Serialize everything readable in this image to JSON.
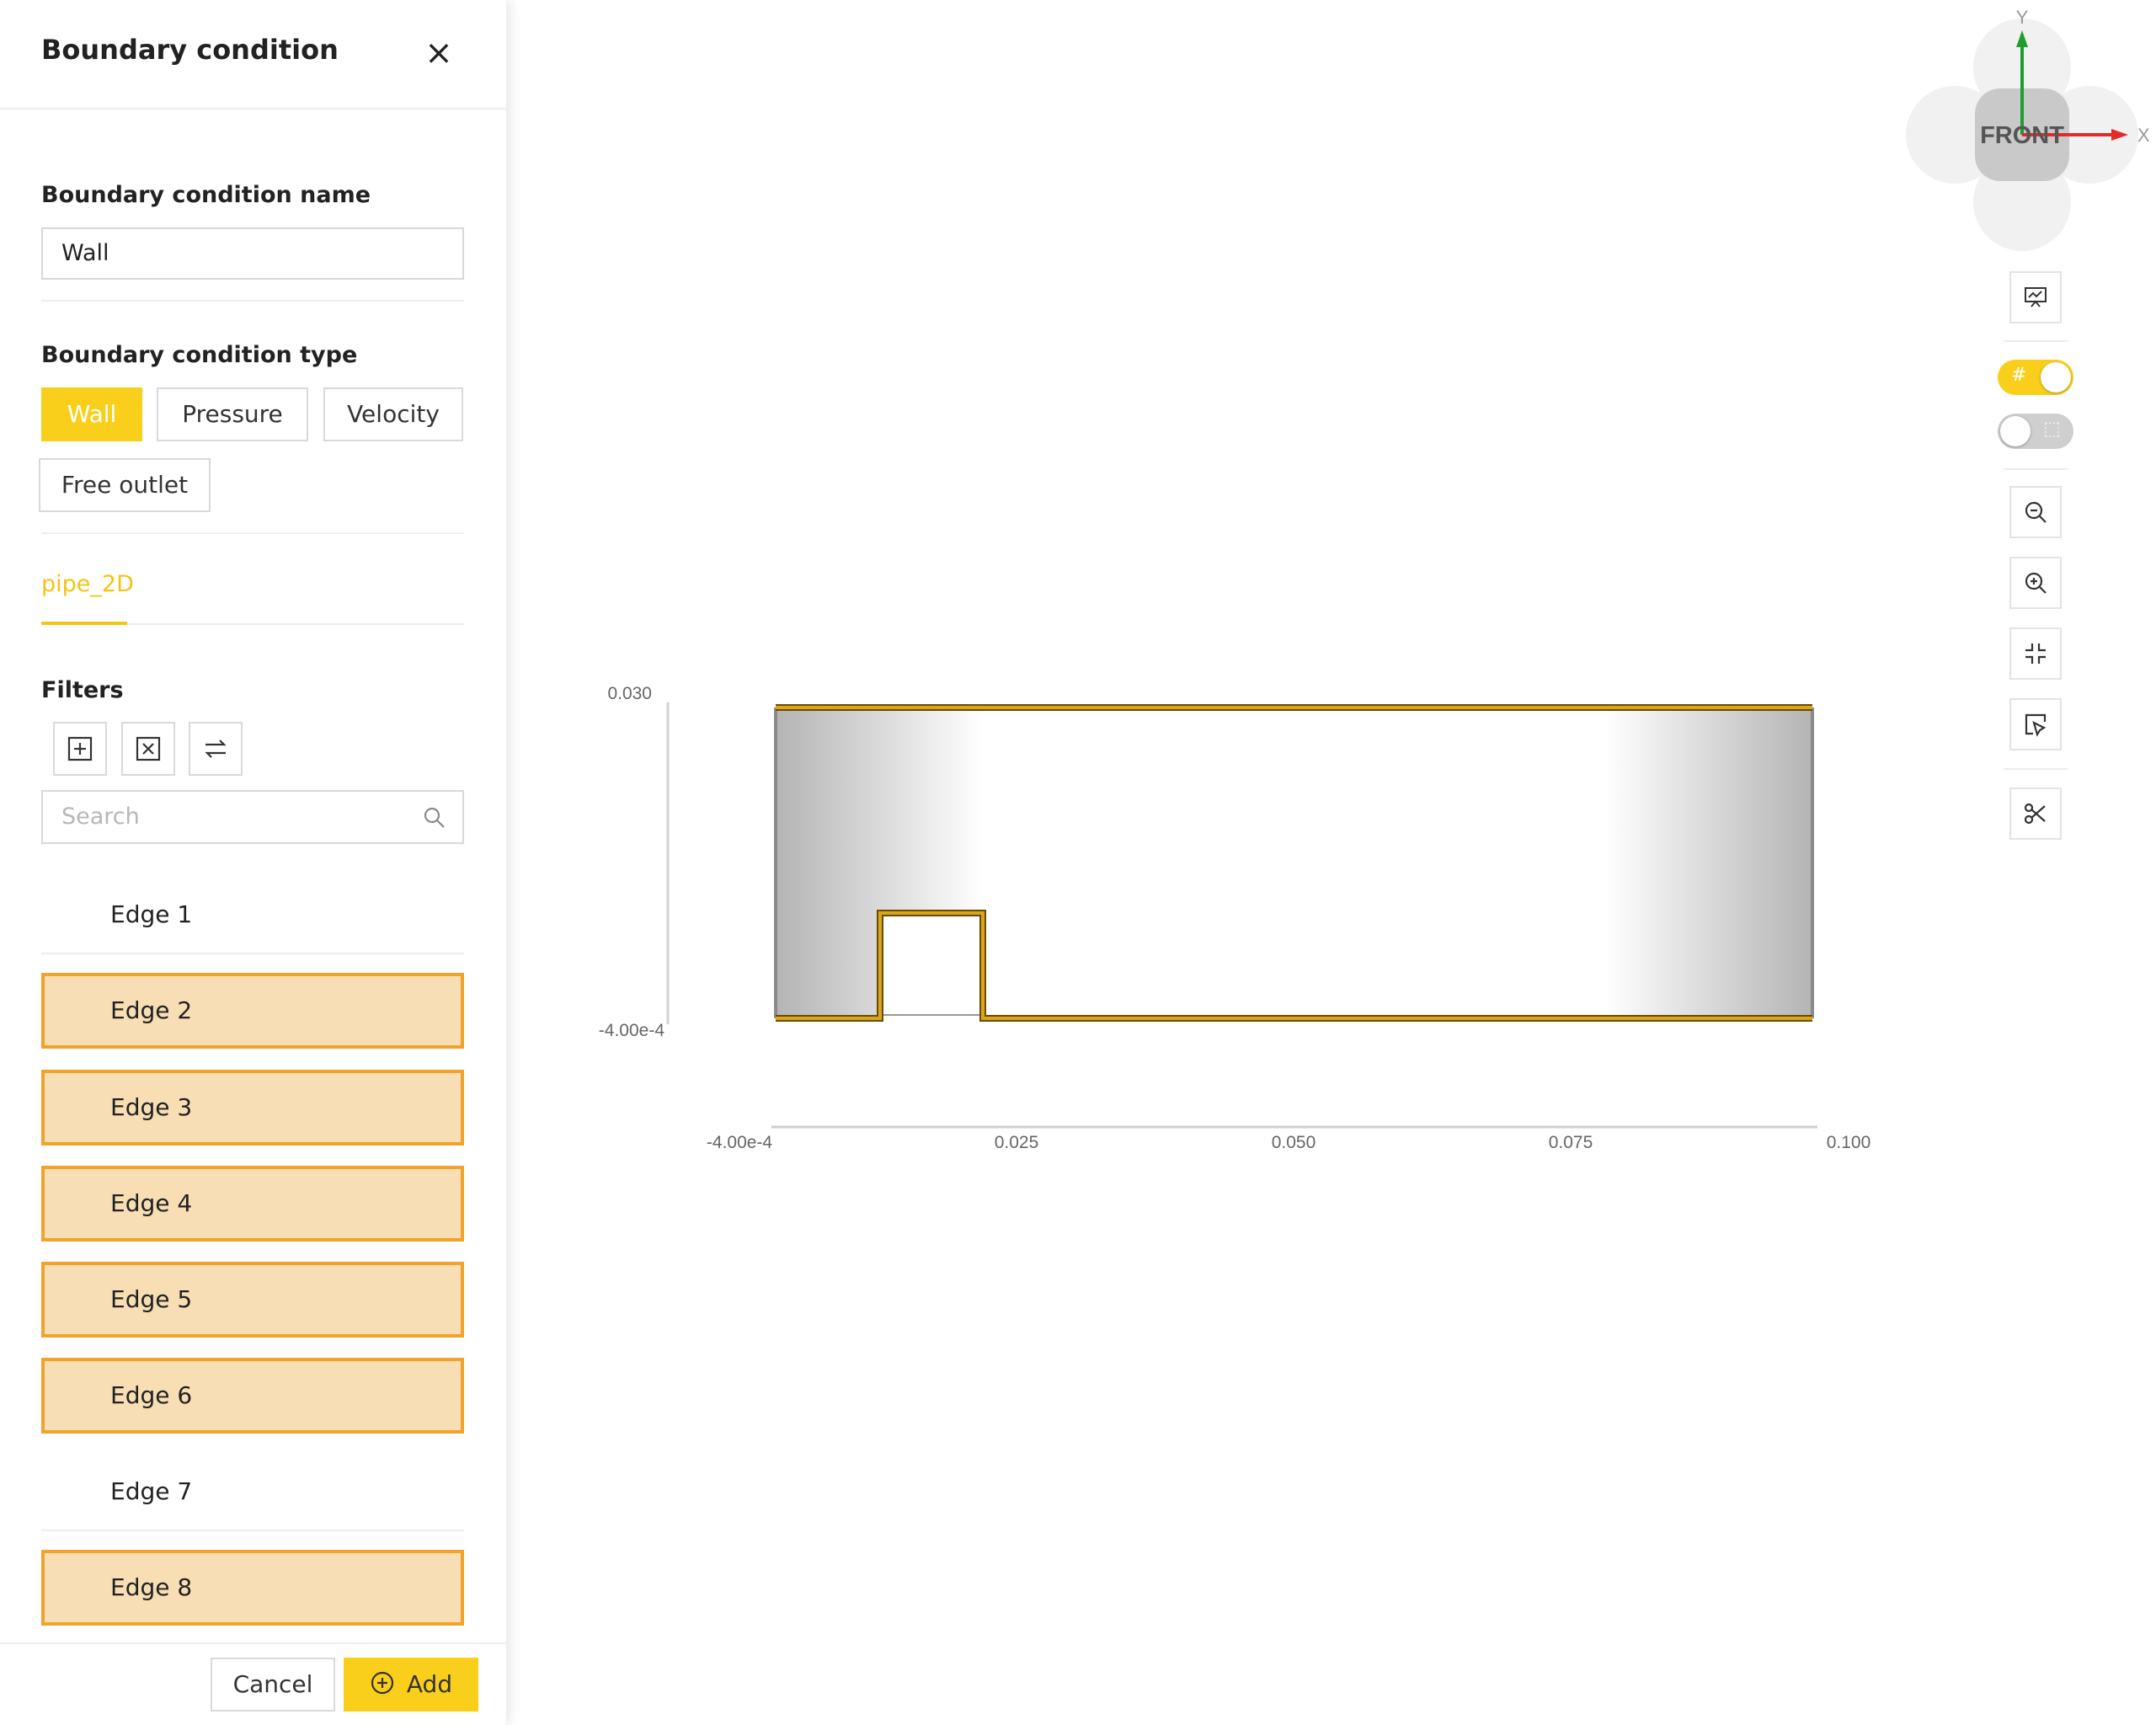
{
  "panel": {
    "title": "Boundary condition",
    "name_label": "Boundary condition name",
    "name_value": "Wall",
    "type_label": "Boundary condition type",
    "types": [
      "Wall",
      "Pressure",
      "Velocity",
      "Free outlet"
    ],
    "selected_type": "Wall",
    "tab": "pipe_2D",
    "filters_label": "Filters",
    "search_placeholder": "Search",
    "edges": [
      {
        "label": "Edge 1",
        "selected": false
      },
      {
        "label": "Edge 2",
        "selected": true
      },
      {
        "label": "Edge 3",
        "selected": true
      },
      {
        "label": "Edge 4",
        "selected": true
      },
      {
        "label": "Edge 5",
        "selected": true
      },
      {
        "label": "Edge 6",
        "selected": true
      },
      {
        "label": "Edge 7",
        "selected": false
      },
      {
        "label": "Edge 8",
        "selected": true
      }
    ],
    "cancel_label": "Cancel",
    "add_label": "Add"
  },
  "viewcube": {
    "face": "FRONT",
    "axis_x": "X",
    "axis_y": "Y"
  },
  "axes": {
    "y_ticks": [
      "0.030",
      "-4.00e-4"
    ],
    "x_ticks": [
      "-4.00e-4",
      "0.025",
      "0.050",
      "0.075",
      "0.100"
    ]
  },
  "toggles": {
    "grid_on": true,
    "second_on": false
  },
  "colors": {
    "accent": "#f9cf1b",
    "selected_fill": "#f8deb5",
    "selected_border": "#f0a22b",
    "edge_highlight": "#b8860b"
  }
}
